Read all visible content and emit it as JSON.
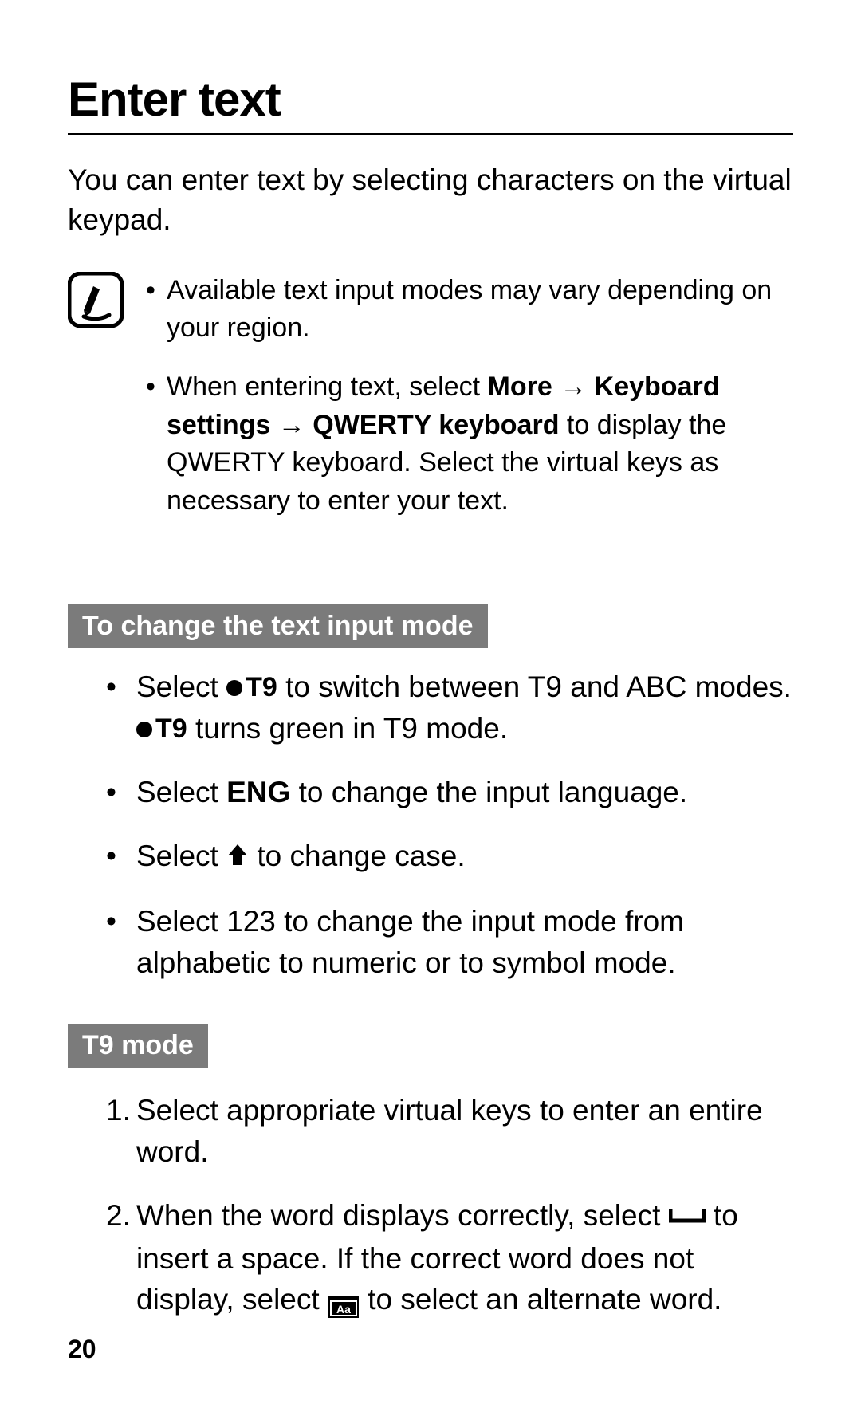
{
  "heading": "Enter text",
  "intro": "You can enter text by selecting characters on the virtual keypad.",
  "note": {
    "item1": "Available text input modes may vary depending on your region.",
    "item2_pre": "When entering text, select ",
    "item2_bold": "More → Keyboard settings → QWERTY keyboard",
    "item2_post": " to display the QWERTY keyboard. Select the virtual keys as necessary to enter your text."
  },
  "section1_label": "To change the text input mode",
  "bullets": {
    "b1_pre": "Select ",
    "t9_label": "T9",
    "b1_mid": " to switch between T9 and ABC modes. ",
    "b1_post": " turns green in T9 mode.",
    "b2_pre": "Select ",
    "b2_bold": "ENG",
    "b2_post": " to change the input language.",
    "b3_pre": "Select ",
    "b3_post": " to change case.",
    "b4": "Select 123 to change the input mode from alphabetic to numeric or to symbol mode."
  },
  "section2_label": "T9 mode",
  "steps": {
    "s1": "Select appropriate virtual keys to enter an entire word.",
    "s2_pre": "When the word displays correctly, select ",
    "s2_mid": " to insert a space. If the correct word does not display, select ",
    "s2_post": " to select an alternate word."
  },
  "page_number": "20"
}
